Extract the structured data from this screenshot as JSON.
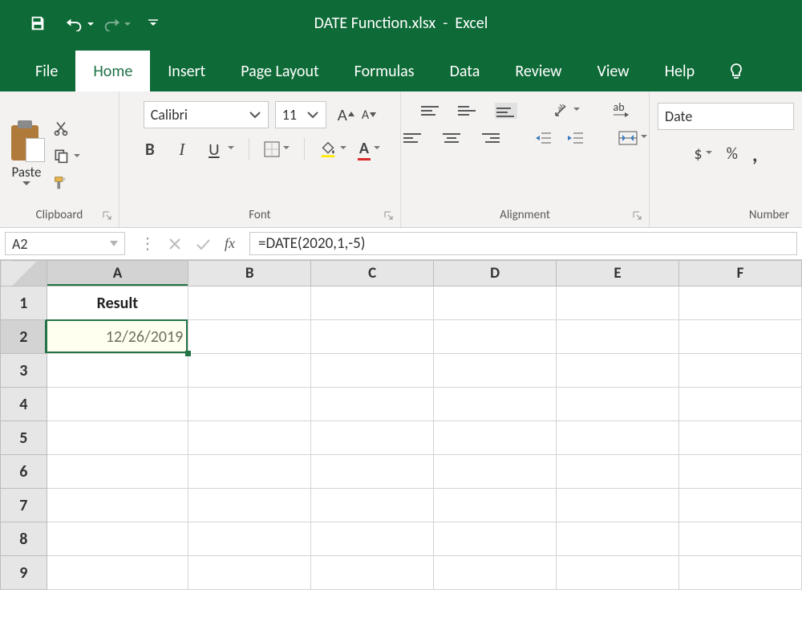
{
  "app": {
    "filename": "DATE Function.xlsx",
    "appname": "Excel"
  },
  "tabs": {
    "file": "File",
    "home": "Home",
    "insert": "Insert",
    "page_layout": "Page Layout",
    "formulas": "Formulas",
    "data": "Data",
    "review": "Review",
    "view": "View",
    "help": "Help"
  },
  "ribbon": {
    "clipboard": {
      "label": "Clipboard",
      "paste": "Paste"
    },
    "font": {
      "label": "Font",
      "name": "Calibri",
      "size": "11",
      "bold": "B",
      "italic": "I",
      "underline": "U",
      "increaseA": "A",
      "decreaseA": "A",
      "fontcolorA": "A"
    },
    "alignment": {
      "label": "Alignment",
      "wrap": "ab"
    },
    "number": {
      "label": "Number",
      "format": "Date",
      "currency": "$",
      "percent": "%",
      "comma": ","
    }
  },
  "formula_bar": {
    "namebox": "A2",
    "fx": "fx",
    "formula": "=DATE(2020,1,-5)"
  },
  "grid": {
    "columns": [
      "A",
      "B",
      "C",
      "D",
      "E",
      "F"
    ],
    "rows": [
      "1",
      "2",
      "3",
      "4",
      "5",
      "6",
      "7",
      "8",
      "9"
    ],
    "cells": {
      "A1": "Result",
      "A2": "12/26/2019"
    },
    "active": "A2"
  }
}
